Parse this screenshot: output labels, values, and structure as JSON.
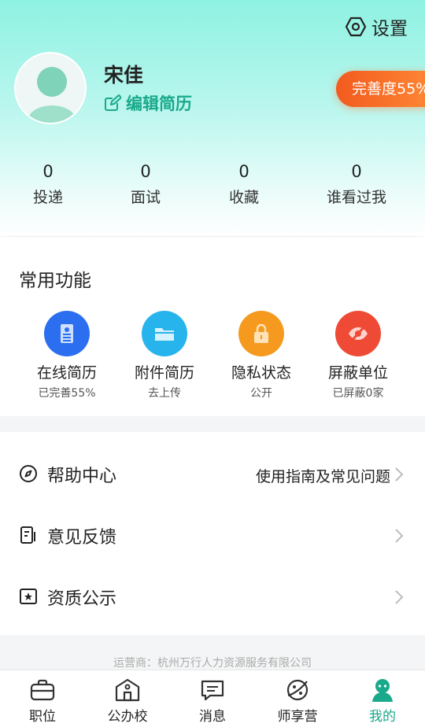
{
  "header": {
    "settings_label": "设置"
  },
  "profile": {
    "name": "宋佳",
    "edit_label": "编辑简历",
    "completion_badge": "完善度55%"
  },
  "stats": [
    {
      "value": "0",
      "label": "投递"
    },
    {
      "value": "0",
      "label": "面试"
    },
    {
      "value": "0",
      "label": "收藏"
    },
    {
      "value": "0",
      "label": "谁看过我"
    }
  ],
  "functions": {
    "title": "常用功能",
    "items": [
      {
        "label": "在线简历",
        "sub": "已完善55%",
        "icon": "resume-icon",
        "color": "#2b6ff0"
      },
      {
        "label": "附件简历",
        "sub": "去上传",
        "icon": "folder-icon",
        "color": "#27b3ec"
      },
      {
        "label": "隐私状态",
        "sub": "公开",
        "icon": "lock-icon",
        "color": "#f59a1e"
      },
      {
        "label": "屏蔽单位",
        "sub": "已屏蔽0家",
        "icon": "eye-off-icon",
        "color": "#ef4a35"
      }
    ]
  },
  "menu": [
    {
      "label": "帮助中心",
      "right": "使用指南及常见问题",
      "icon": "compass-icon"
    },
    {
      "label": "意见反馈",
      "right": "",
      "icon": "feedback-icon"
    },
    {
      "label": "资质公示",
      "right": "",
      "icon": "certificate-icon"
    }
  ],
  "footer": {
    "operator": "运营商：杭州万行人力资源服务有限公司"
  },
  "tabbar": [
    {
      "label": "职位",
      "icon": "briefcase-icon",
      "active": false
    },
    {
      "label": "公办校",
      "icon": "school-icon",
      "active": false
    },
    {
      "label": "消息",
      "icon": "message-icon",
      "active": false
    },
    {
      "label": "师享营",
      "icon": "planet-icon",
      "active": false
    },
    {
      "label": "我的",
      "icon": "profile-icon",
      "active": true
    }
  ],
  "colors": {
    "accent": "#19a98b",
    "badge_start": "#f25b1f",
    "badge_end": "#ff8a36"
  }
}
